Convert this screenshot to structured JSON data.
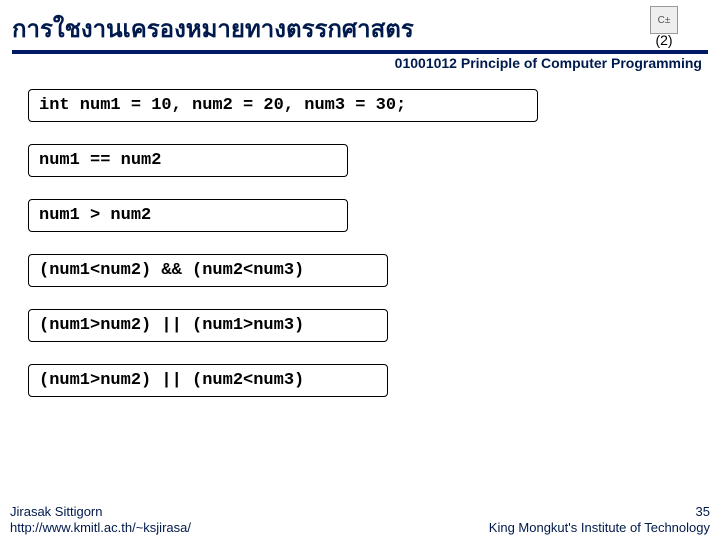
{
  "header": {
    "title": "การใชงานเครองหมายทางตรรกศาสตร",
    "logo_label": "C±",
    "subnumber": "(2)",
    "course_line": "01001012 Principle of Computer Programming"
  },
  "lines": {
    "l0": "int num1 = 10, num2 = 20, num3 = 30;",
    "l1": "num1 == num2",
    "l2": "num1 > num2",
    "l3": "(num1<num2) && (num2<num3)",
    "l4": "(num1>num2) || (num1>num3)",
    "l5": "(num1>num2) || (num2<num3)"
  },
  "footer": {
    "author": "Jirasak Sittigorn",
    "url": "http://www.kmitl.ac.th/~ksjirasa/",
    "slide_number": "35",
    "institution": "King Mongkut's Institute of Technology"
  }
}
